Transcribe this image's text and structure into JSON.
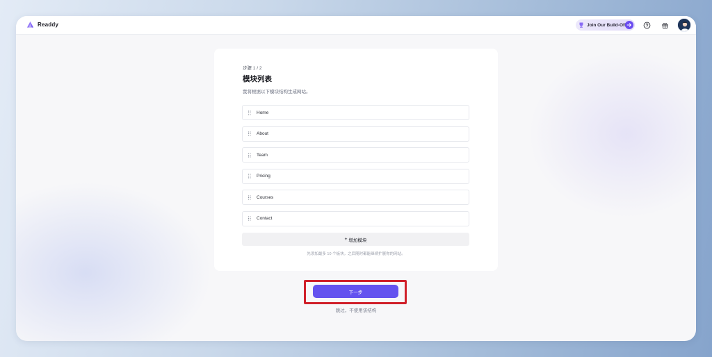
{
  "app": {
    "name": "Readdy"
  },
  "header": {
    "build_off_label": "Join Our Build-Off",
    "icons": [
      "help-icon",
      "gift-icon"
    ],
    "accent": "#6a4cf0"
  },
  "card": {
    "step": "步骤 1 / 2",
    "title": "模块列表",
    "description": "我将根据以下模块结构生成网站。",
    "modules": [
      {
        "label": "Home"
      },
      {
        "label": "About"
      },
      {
        "label": "Team"
      },
      {
        "label": "Pricing"
      },
      {
        "label": "Courses"
      },
      {
        "label": "Contact"
      }
    ],
    "add_module_plus": "+",
    "add_module_label": "增加模块",
    "hint": "先添加最多 10 个板块，之后随时都能继续扩展你的网站。"
  },
  "actions": {
    "next_label": "下一步",
    "skip_label": "跳过，不使用该结构",
    "primary_color": "#6352ef",
    "highlight_color": "#d0202a"
  }
}
